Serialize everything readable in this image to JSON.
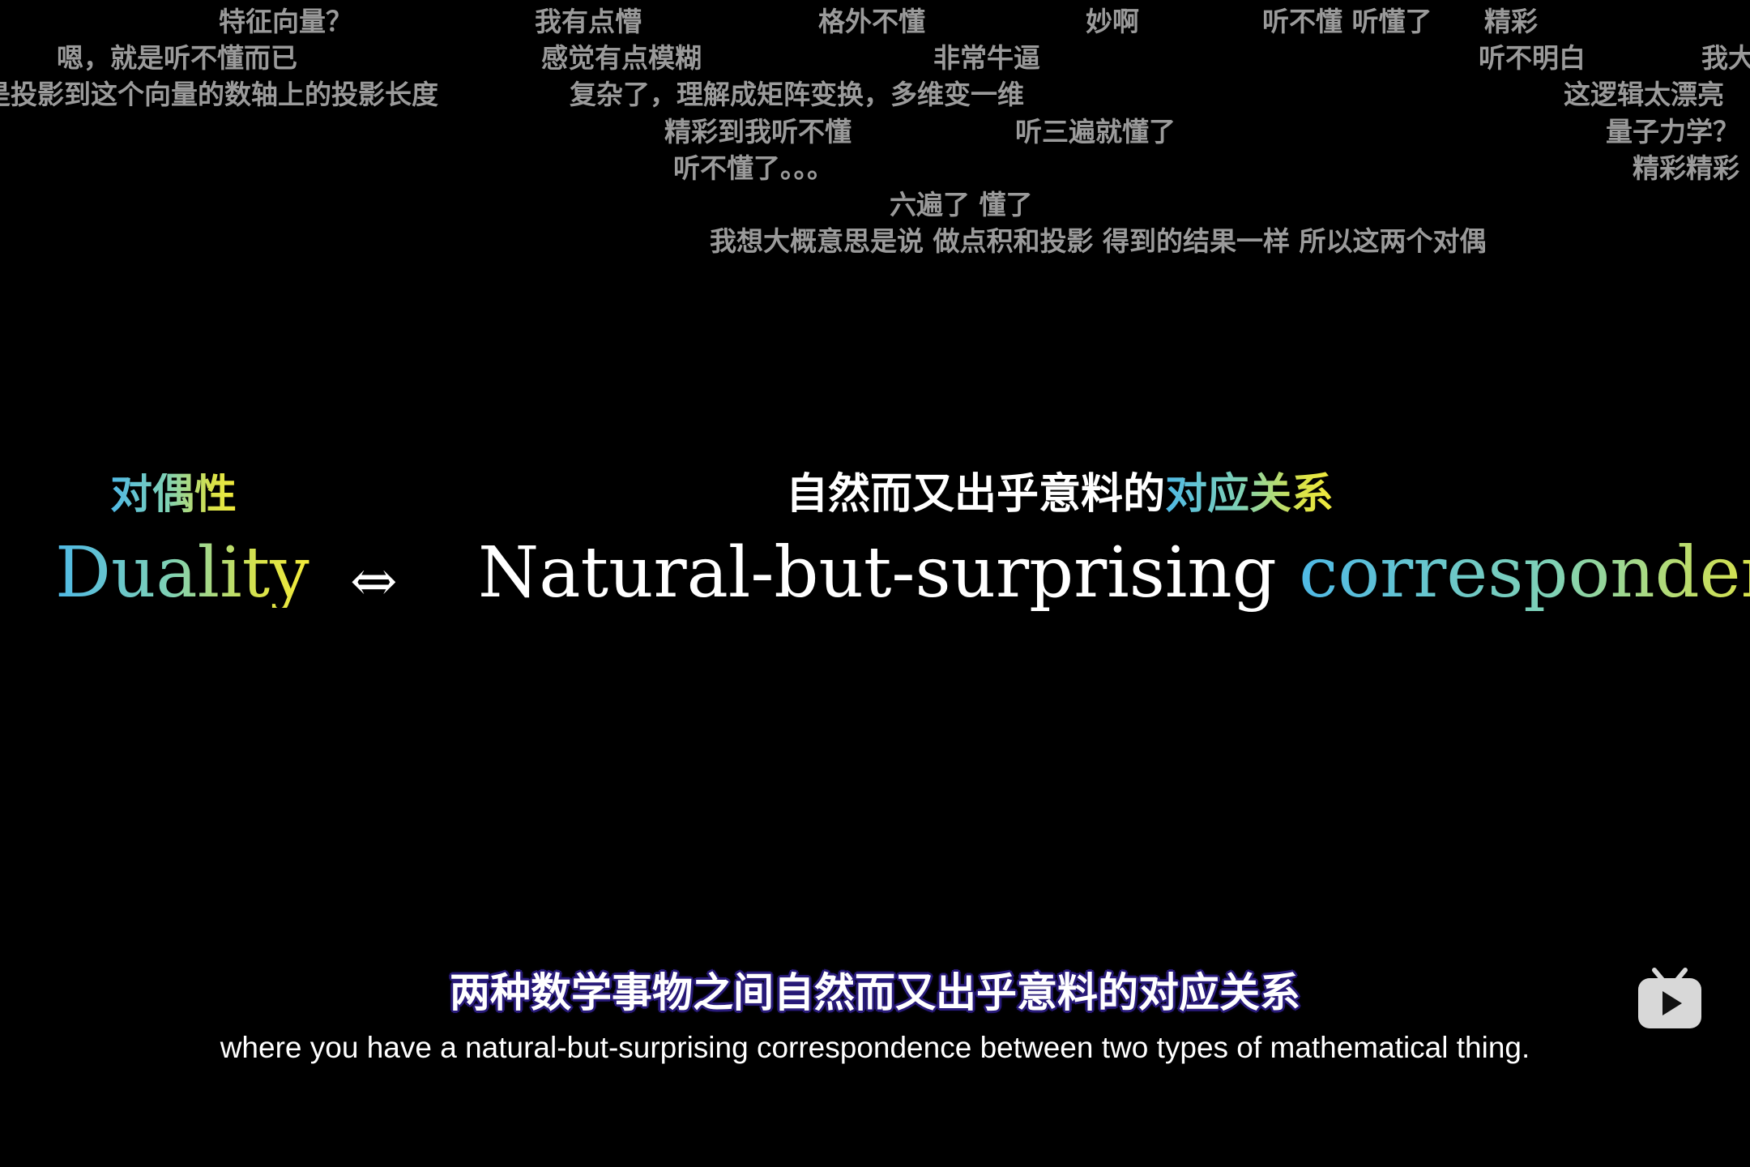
{
  "danmaku": [
    "特征向量？",
    "我有点懵",
    "格外不懂",
    "妙啊",
    "听不懂 听懂了",
    "精彩",
    "嗯，就是听不懂而已",
    "感觉有点模糊",
    "非常牛逼",
    "听不明白",
    "我大",
    "是投影到这个向量的数轴上的投影长度",
    "复杂了，理解成矩阵变换，多维变一维",
    "这逻辑太漂亮",
    "精彩到我听不懂",
    "听三遍就懂了",
    "量子力学？",
    "听不懂了。。。",
    "精彩精彩",
    "六遍了  懂了",
    "我想大概意思是说  做点积和投影  得到的结果一样  所以这两个对偶"
  ],
  "heading": {
    "cn_left": "对偶性",
    "cn_right_plain": "自然而又出乎意料的",
    "cn_right_colored": "对应关系",
    "en_left": "Duality",
    "arrow": "⇔",
    "en_right_plain": "Natural-but-surprising",
    "en_right_colored": "correspondence"
  },
  "subtitle": {
    "cn": "两种数学事物之间自然而又出乎意料的对应关系",
    "en": "where you have a natural-but-surprising correspondence between two types of mathematical thing."
  },
  "logo": {
    "icon": "bilibili-tv-icon"
  },
  "colors": {
    "gradient_start": "#4fb9e6",
    "gradient_end": "#f2ea3b",
    "danmaku": "#9a9a9a",
    "subtitle_outline": "#2a1c7a"
  }
}
